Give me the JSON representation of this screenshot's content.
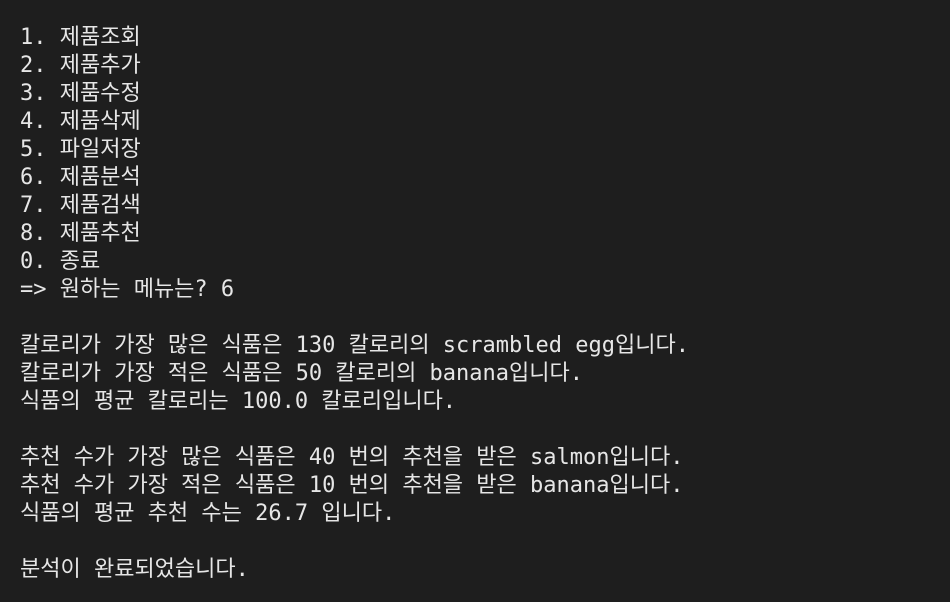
{
  "terminal": {
    "menu": [
      "1. 제품조회",
      "2. 제품추가",
      "3. 제품수정",
      "4. 제품삭제",
      "5. 파일저장",
      "6. 제품분석",
      "7. 제품검색",
      "8. 제품추천",
      "0. 종료"
    ],
    "prompt": "=> 원하는 메뉴는? 6",
    "calorie_lines": [
      "칼로리가 가장 많은 식품은 130 칼로리의 scrambled egg입니다.",
      "칼로리가 가장 적은 식품은 50 칼로리의 banana입니다.",
      "식품의 평균 칼로리는 100.0 칼로리입니다."
    ],
    "recommend_lines": [
      "추천 수가 가장 많은 식품은 40 번의 추천을 받은 salmon입니다.",
      "추천 수가 가장 적은 식품은 10 번의 추천을 받은 banana입니다.",
      "식품의 평균 추천 수는 26.7 입니다."
    ],
    "done": "분석이 완료되었습니다."
  }
}
